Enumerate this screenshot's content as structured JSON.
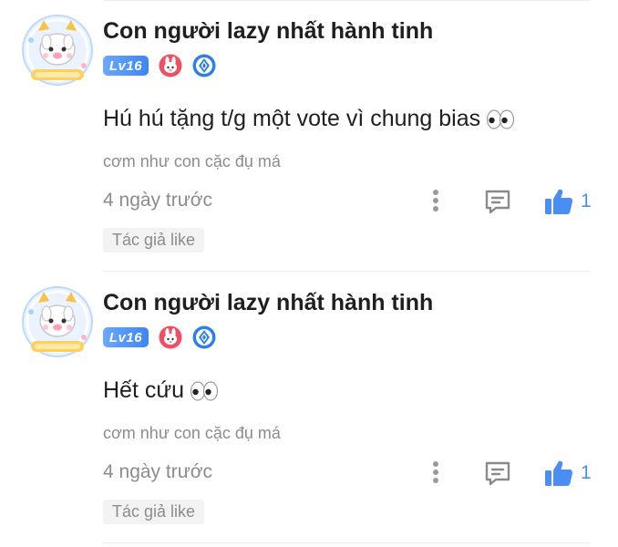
{
  "colors": {
    "accent": "#4a8ef5",
    "muted": "#8c8c8c",
    "badge_blue": "#3c86f5"
  },
  "comments": [
    {
      "username": "Con người lazy nhất hành tinh",
      "level": "Lv16",
      "content": "Hú hú tặng t/g một vote vì chung bias",
      "content_emoji": "eyes-emoji",
      "signature": "cơm như con cặc đụ má",
      "timestamp": "4 ngày trước",
      "likes": "1",
      "author_like": "Tác giả like"
    },
    {
      "username": "Con người lazy nhất hành tinh",
      "level": "Lv16",
      "content": "Hết cứu",
      "content_emoji": "eyes-emoji",
      "signature": "cơm như con cặc đụ má",
      "timestamp": "4 ngày trước",
      "likes": "1",
      "author_like": "Tác giả like"
    }
  ],
  "icons": {
    "more": "more-vertical-icon",
    "reply": "comment-icon",
    "like": "thumbs-up-icon"
  }
}
